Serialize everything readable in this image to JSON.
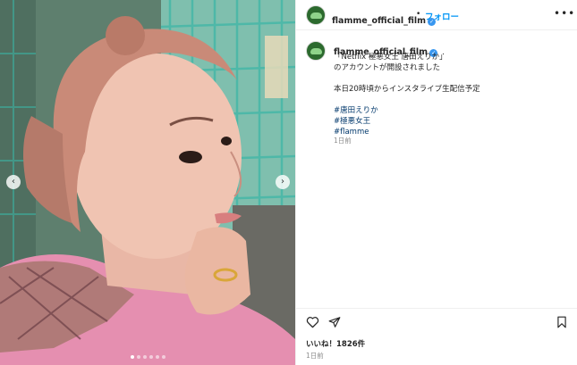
{
  "post": {
    "username": "flamme_official_film",
    "follow_label": "フォロー",
    "separator": "•",
    "more_label": "•••",
    "caption": {
      "username": "flamme_official_film",
      "trailing_dot": ".",
      "line1": "「Netflix 極悪女王 唐田えりか」",
      "line2": "のアカウントが開設されました",
      "line3": "本日20時頃からインスタライブ生配信予定",
      "hashtags": [
        "#唐田えりか",
        "#極悪女王",
        "#flamme"
      ],
      "time": "1日前"
    },
    "likes": "いいね！1826件",
    "time": "1日前"
  },
  "carousel": {
    "prev_label": "‹",
    "next_label": "›",
    "slide_count": 6,
    "active_slide": 1
  },
  "icons": [
    "heart-icon",
    "share-icon",
    "bookmark-icon",
    "verified-icon",
    "chevron-left-icon",
    "chevron-right-icon"
  ],
  "colors": {
    "link_blue": "#0095f6",
    "hashtag": "#00376b",
    "muted": "#8e8e8e",
    "verified": "#3897f0"
  }
}
